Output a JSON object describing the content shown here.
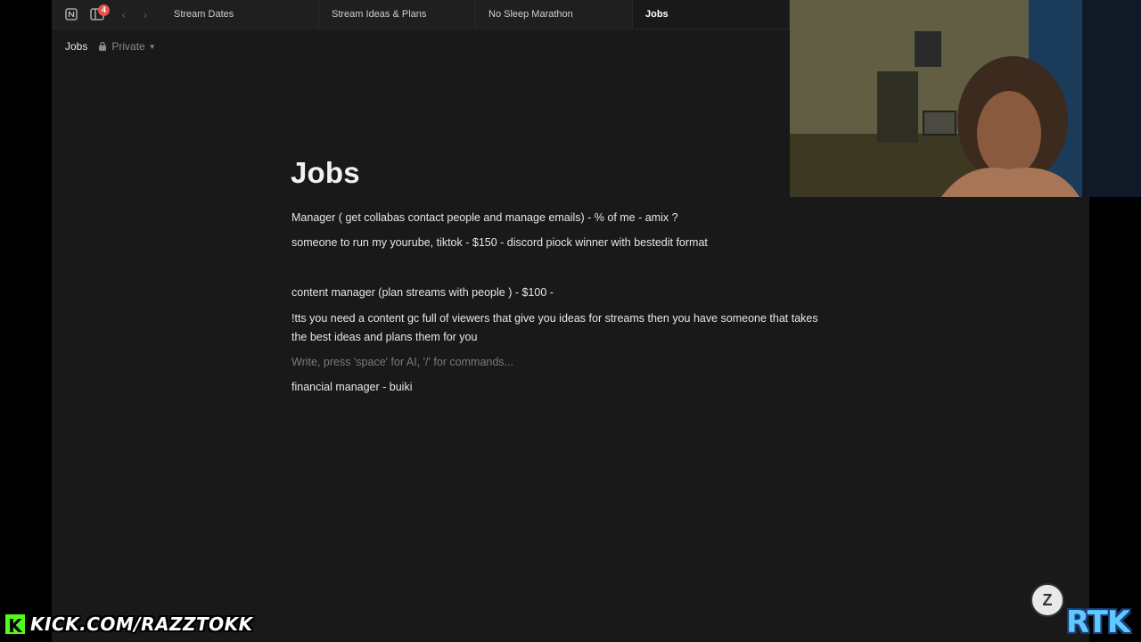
{
  "tabs": {
    "notification_count": "4",
    "items": [
      {
        "label": "Stream Dates"
      },
      {
        "label": "Stream Ideas & Plans"
      },
      {
        "label": "No Sleep Marathon"
      },
      {
        "label": "Jobs"
      }
    ]
  },
  "breadcrumb": {
    "page": "Jobs",
    "privacy": "Private"
  },
  "page": {
    "title": "Jobs",
    "blocks": [
      "Manager ( get collabas contact people and manage emails)  - % of me  - amix ?",
      "someone to run my yourube, tiktok  - $150 - discord piock winner with bestedit format",
      "",
      "content manager (plan streams with people ) - $100 -",
      "!tts you need a content gc full of viewers that give you ideas for streams then you have someone that takes the best ideas and plans them for you",
      "Write, press 'space' for AI, '/' for commands...",
      "financial manager - buiki"
    ]
  },
  "overlay": {
    "kick_logo": "K",
    "kick_url": "KICK.COM/RAZZTOKK",
    "brand": "RTK"
  },
  "colors": {
    "background": "#191919",
    "tabbar": "#1f1f1f",
    "badge": "#e5534b",
    "kick_green": "#53fc18",
    "rtk_blue": "#5ec8ff"
  }
}
